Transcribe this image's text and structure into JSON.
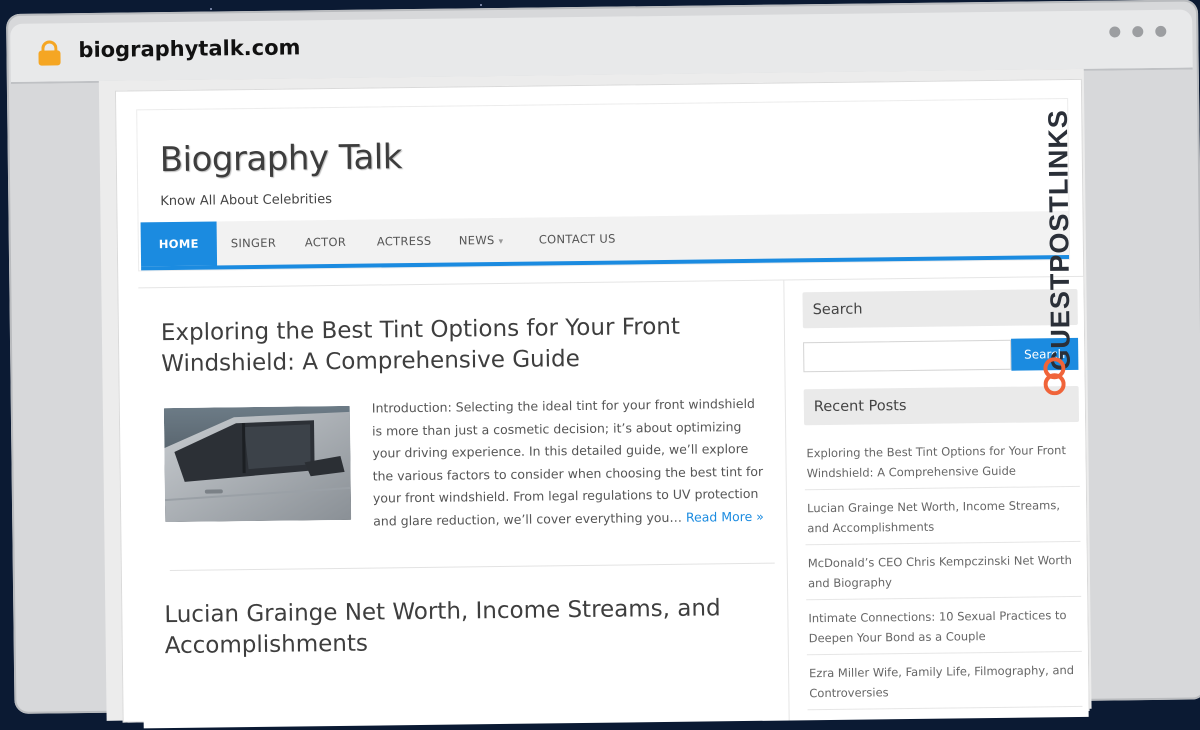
{
  "browser": {
    "url": "biographytalk.com"
  },
  "side_brand": {
    "text": "GUESTPOSTLINKS",
    "accent_color": "#f0643a"
  },
  "site": {
    "title": "Biography Talk",
    "tagline": "Know All About Celebrities"
  },
  "nav": {
    "items": [
      {
        "label": "HOME",
        "active": true
      },
      {
        "label": "SINGER"
      },
      {
        "label": "ACTOR"
      },
      {
        "label": "ACTRESS"
      },
      {
        "label": "NEWS",
        "has_dropdown": true
      },
      {
        "label": "CONTACT US"
      }
    ]
  },
  "posts": [
    {
      "title": "Exploring the Best Tint Options for Your Front Windshield: A Comprehensive Guide",
      "excerpt": "Introduction:  Selecting the ideal tint for your front windshield is more than just a cosmetic decision; it’s about optimizing your driving experience. In this detailed guide, we’ll explore the various factors to consider when choosing the best tint for your front windshield. From legal regulations to UV protection and glare reduction, we’ll cover everything you…",
      "read_more": "Read More »"
    },
    {
      "title": "Lucian Grainge Net Worth, Income Streams, and Accomplishments"
    }
  ],
  "sidebar": {
    "search": {
      "title": "Search",
      "button_label": "Search",
      "placeholder": ""
    },
    "recent_posts": {
      "title": "Recent Posts",
      "items": [
        "Exploring the Best Tint Options for Your Front Windshield: A Comprehensive Guide",
        "Lucian Grainge Net Worth, Income Streams, and Accomplishments",
        "McDonald’s CEO Chris Kempczinski Net Worth and Biography",
        "Intimate Connections: 10 Sexual Practices to Deepen Your Bond as a Couple",
        "Ezra Miller Wife, Family Life, Filmography, and Controversies"
      ]
    }
  },
  "colors": {
    "accent": "#1b8be0",
    "background": "#0b1a33"
  }
}
